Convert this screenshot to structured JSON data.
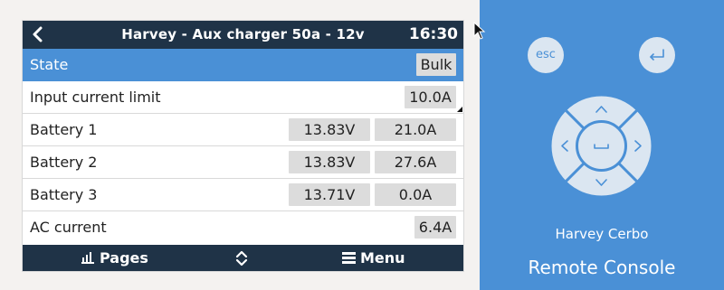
{
  "header": {
    "title": "Harvey - Aux charger 50a - 12v",
    "time": "16:30"
  },
  "rows": [
    {
      "label": "State",
      "values": [
        "Bulk"
      ]
    },
    {
      "label": "Input current limit",
      "values": [
        "10.0A"
      ]
    },
    {
      "label": "Battery 1",
      "values": [
        "13.83V",
        "21.0A"
      ]
    },
    {
      "label": "Battery 2",
      "values": [
        "13.83V",
        "27.6A"
      ]
    },
    {
      "label": "Battery 3",
      "values": [
        "13.71V",
        "0.0A"
      ]
    },
    {
      "label": "AC current",
      "values": [
        "6.4A"
      ]
    }
  ],
  "footer": {
    "pages_label": "Pages",
    "menu_label": "Menu"
  },
  "remote": {
    "esc_label": "esc",
    "device_name": "Harvey Cerbo",
    "title": "Remote Console"
  },
  "colors": {
    "titlebar": "#1f3347",
    "selected_row": "#4a90d6",
    "panel": "#4a90d6",
    "value_bg": "#dcdcdc"
  }
}
